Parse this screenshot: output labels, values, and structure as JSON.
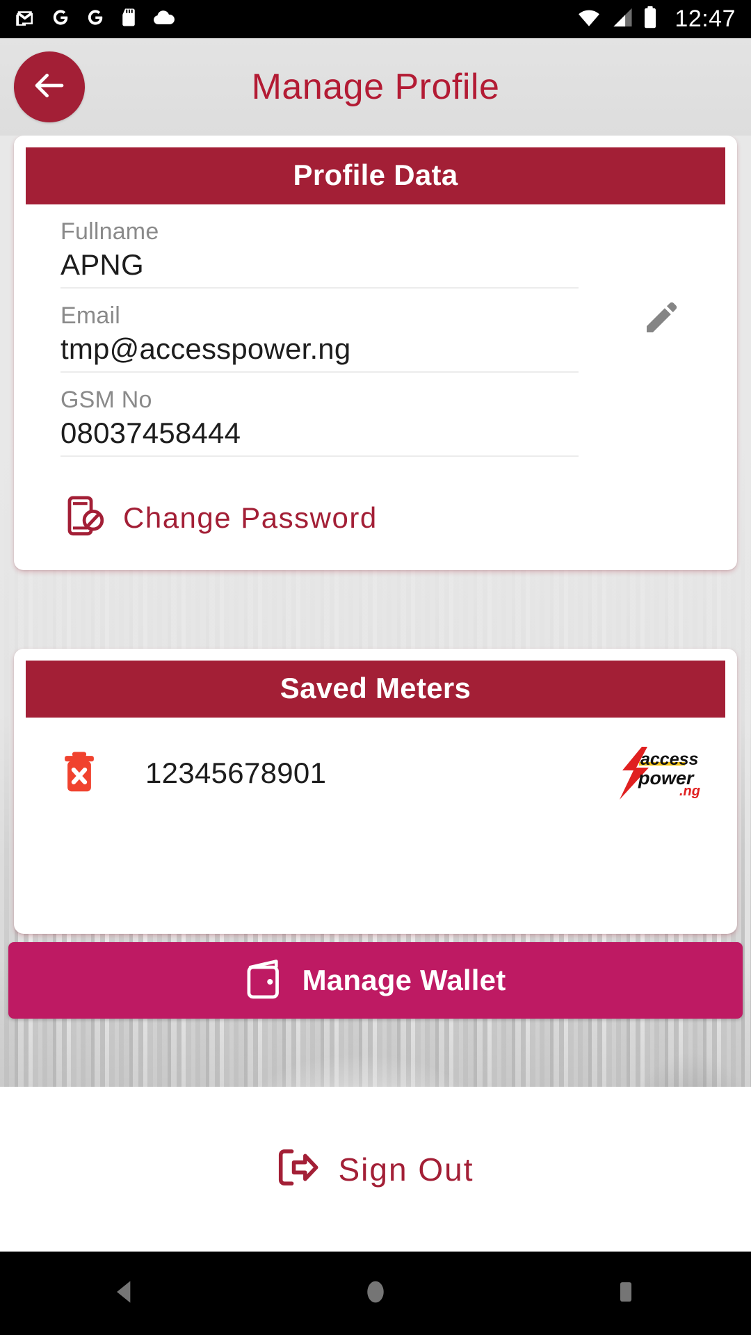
{
  "status_bar": {
    "time": "12:47",
    "left_icons": [
      "gmail-icon",
      "google-icon",
      "google-icon",
      "sd-card-icon",
      "cloud-icon"
    ],
    "right_icons": [
      "wifi-icon",
      "signal-icon",
      "battery-icon"
    ]
  },
  "app_bar": {
    "back_icon": "arrow-left-icon",
    "title": "Manage Profile",
    "title_color": "#b31b34",
    "accent_color": "#a31f36"
  },
  "profile_card": {
    "header": "Profile Data",
    "edit_icon": "pencil-icon",
    "fields": [
      {
        "label": "Fullname",
        "value": "APNG"
      },
      {
        "label": "Email",
        "value": "tmp@accesspower.ng"
      },
      {
        "label": "GSM No",
        "value": "08037458444"
      }
    ],
    "change_password": {
      "label": "Change Password",
      "icon": "phone-block-icon",
      "color": "#a31f36"
    }
  },
  "saved_meters_card": {
    "header": "Saved Meters",
    "rows": [
      {
        "meter_number": "12345678901",
        "delete_icon": "trash-x-icon",
        "logo": "access-power-ng-logo"
      }
    ]
  },
  "wallet_button": {
    "label": "Manage Wallet",
    "icon": "wallet-icon",
    "color": "#be1a63"
  },
  "sign_out": {
    "label": "Sign Out",
    "icon": "logout-icon",
    "color": "#a31f36"
  },
  "nav_bar": {
    "items": [
      "back-nav-icon",
      "home-nav-icon",
      "recents-nav-icon"
    ]
  },
  "brand": {
    "logo_word_1": "access",
    "logo_word_2": "power",
    "logo_suffix": ".ng"
  }
}
